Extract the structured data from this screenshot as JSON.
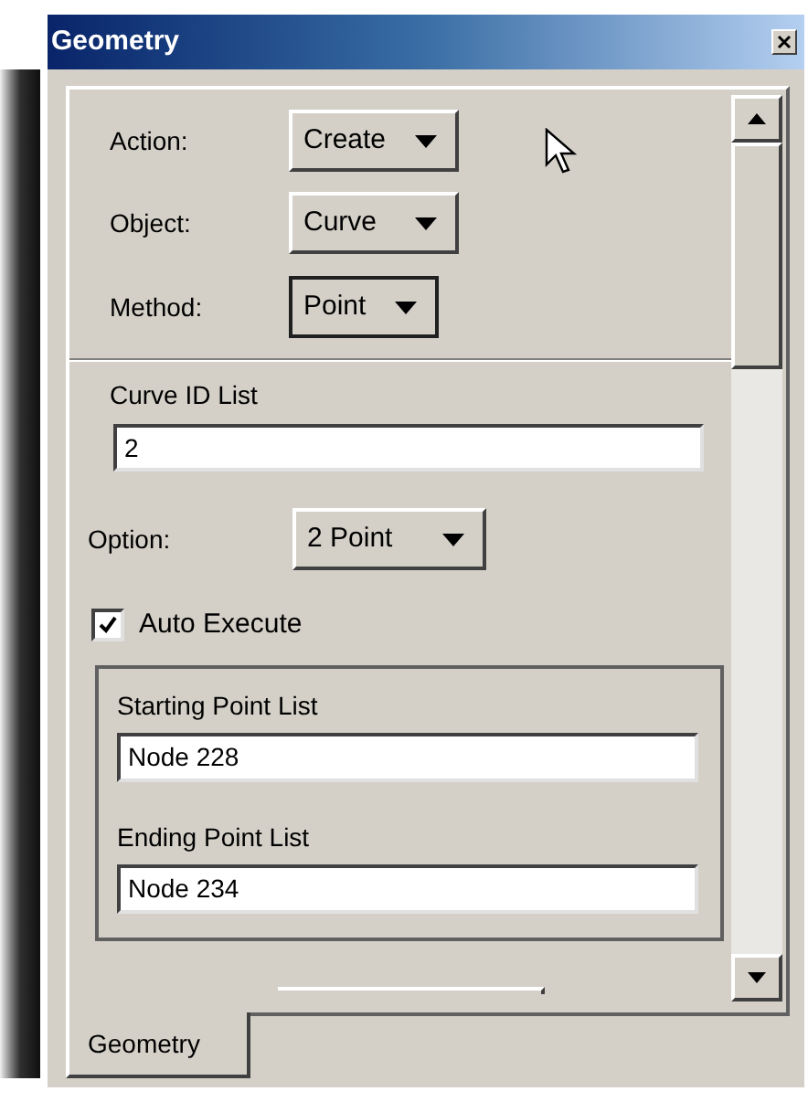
{
  "window": {
    "title": "Geometry"
  },
  "selectors": [
    {
      "label": "Action:",
      "value": "Create",
      "focused": false
    },
    {
      "label": "Object:",
      "value": "Curve",
      "focused": false
    },
    {
      "label": "Method:",
      "value": "Point",
      "focused": true
    }
  ],
  "curve_id_list": {
    "label": "Curve ID List",
    "value": "2"
  },
  "option": {
    "label": "Option:",
    "value": "2 Point",
    "focused": false
  },
  "auto_execute": {
    "label": "Auto Execute",
    "checked": true
  },
  "point_lists": [
    {
      "label": "Starting Point List",
      "value": "Node 228"
    },
    {
      "label": "Ending Point List",
      "value": "Node 234"
    }
  ],
  "tabs": [
    {
      "label": "Geometry",
      "selected": true
    }
  ]
}
